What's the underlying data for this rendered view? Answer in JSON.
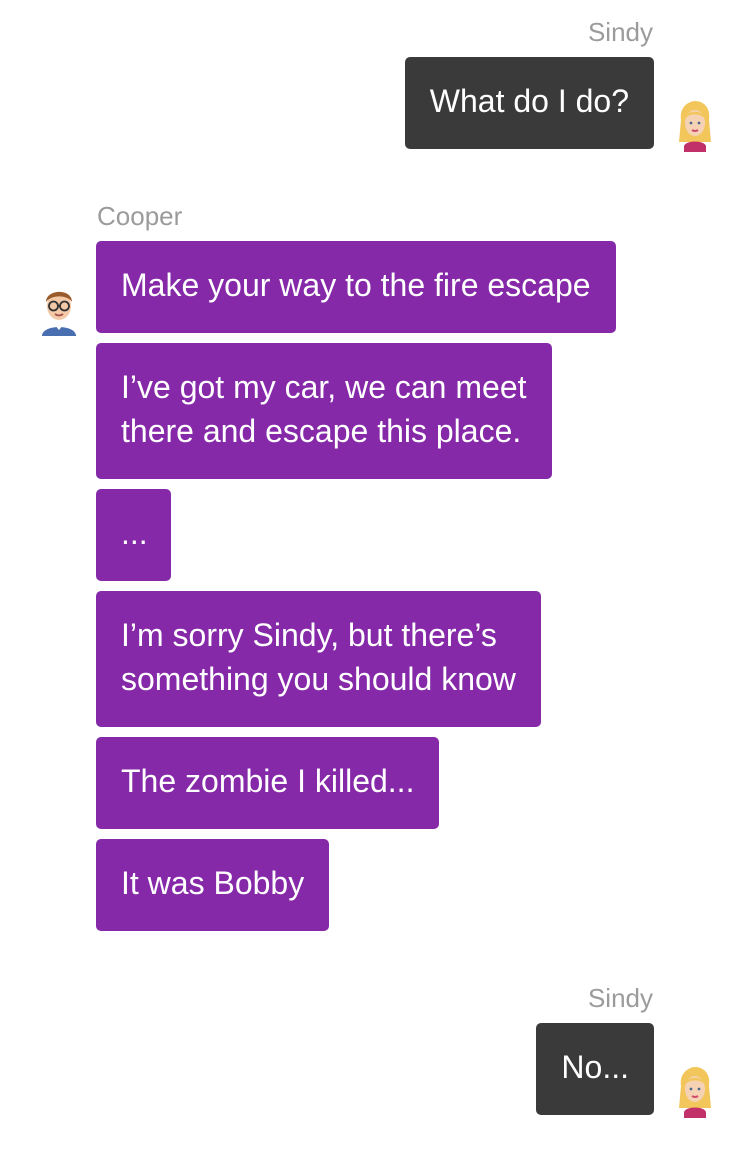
{
  "chat": {
    "colors": {
      "outgoing_bubble": "#3a3a3a",
      "incoming_bubble": "#8529a9",
      "sender_name": "#9b9b9b",
      "bubble_text": "#ffffff"
    },
    "groups": [
      {
        "sender": "Sindy",
        "side": "right",
        "avatar": "sindy-avatar-icon",
        "messages": [
          "What do I do?"
        ]
      },
      {
        "sender": "Cooper",
        "side": "left",
        "avatar": "cooper-avatar-icon",
        "messages": [
          "Make your way to the fire escape",
          "I’ve got my car, we can meet\nthere and escape this place.",
          "...",
          "I’m sorry Sindy, but there’s\nsomething you should know",
          "The zombie I killed...",
          "It was Bobby"
        ]
      },
      {
        "sender": "Sindy",
        "side": "right",
        "avatar": "sindy-avatar-icon",
        "messages": [
          "No..."
        ]
      }
    ]
  }
}
